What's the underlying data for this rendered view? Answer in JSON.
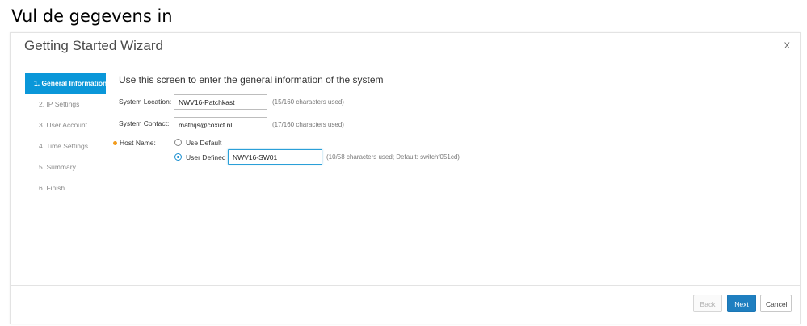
{
  "caption": "Vul de gegevens in",
  "dialog": {
    "title": "Getting Started Wizard",
    "close_label": "X"
  },
  "steps": [
    {
      "label": "1. General Information",
      "active": true
    },
    {
      "label": "2. IP Settings",
      "active": false
    },
    {
      "label": "3. User Account",
      "active": false
    },
    {
      "label": "4. Time Settings",
      "active": false
    },
    {
      "label": "5. Summary",
      "active": false
    },
    {
      "label": "6. Finish",
      "active": false
    }
  ],
  "main": {
    "title": "Use this screen to enter the general information of the system",
    "system_location": {
      "label": "System Location:",
      "value": "NWV16-Patchkast",
      "count": "(15/160 characters used)"
    },
    "system_contact": {
      "label": "System Contact:",
      "value": "mathijs@coxict.nl",
      "count": "(17/160 characters used)"
    },
    "host_name": {
      "label": "Host Name:",
      "option_default": "Use Default",
      "option_user_defined": "User Defined",
      "selected": "User Defined",
      "value": "NWV16-SW01",
      "count": "(10/58 characters used; Default: switchf051cd)"
    }
  },
  "footer": {
    "back_label": "Back",
    "next_label": "Next",
    "cancel_label": "Cancel"
  },
  "colors": {
    "accent": "#0a97d9",
    "primary_button": "#1f7fc0",
    "required_marker": "#f29b1d"
  }
}
